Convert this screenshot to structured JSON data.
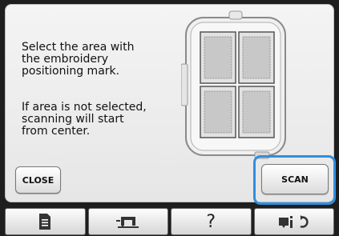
{
  "message": {
    "line1": "Select the area with\nthe embroidery\npositioning mark.",
    "line2": "If area is not selected,\nscanning will start\nfrom center."
  },
  "buttons": {
    "close_label": "CLOSE",
    "scan_label": "SCAN"
  },
  "toolbar": {
    "help_label": "?"
  },
  "icons": [
    "document-icon",
    "sewing-machine-icon",
    "help-icon",
    "image-rotate-icon"
  ],
  "colors": {
    "highlight": "#2f8fe0",
    "panel": "#eeeeee",
    "bar": "#1e1e1e"
  }
}
